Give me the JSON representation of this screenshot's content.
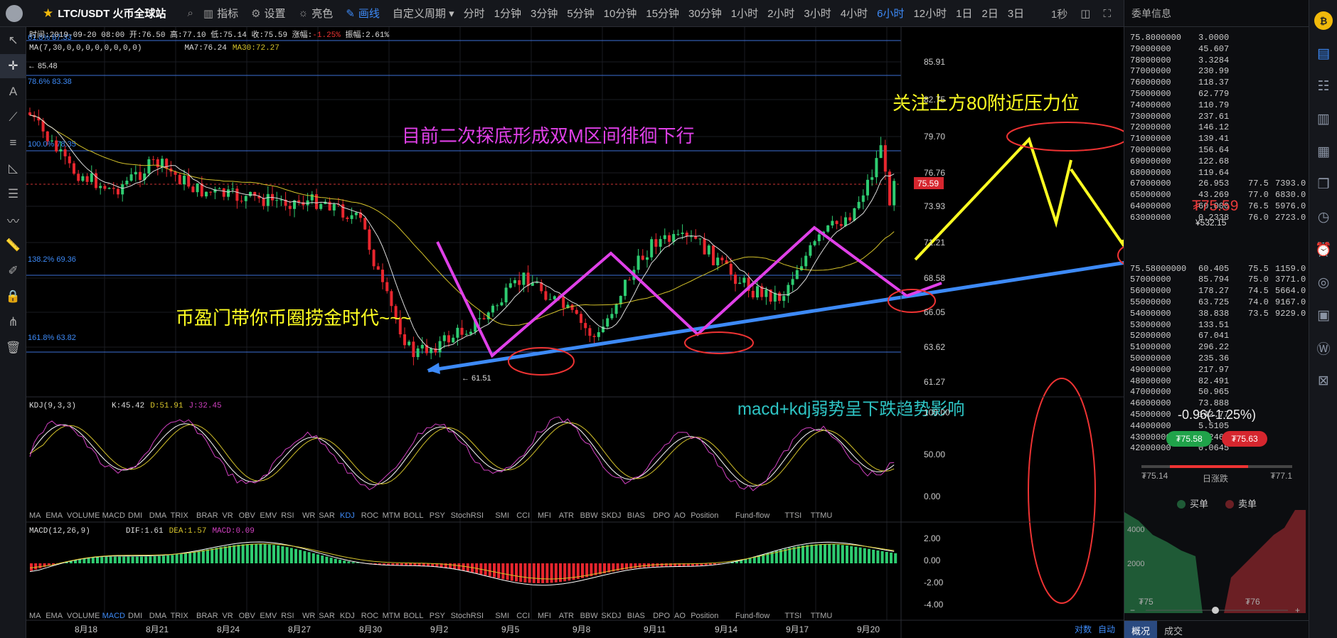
{
  "top": {
    "pair": "LTC/USDT 火币全球站",
    "tools": [
      "指标",
      "设置",
      "亮色",
      "画线"
    ],
    "periods": [
      "自定义周期",
      "分时",
      "1分钟",
      "3分钟",
      "5分钟",
      "10分钟",
      "15分钟",
      "30分钟",
      "1小时",
      "2小时",
      "3小时",
      "4小时",
      "6小时",
      "12小时",
      "1日",
      "2日",
      "3日"
    ],
    "active_period": "6小时",
    "right": [
      "1秒"
    ]
  },
  "info": {
    "line": "时间:2019-09-20 08:00  开:76.50  高:77.10  低:75.14  收:75.59",
    "change_label": "涨幅:",
    "change": "-1.25%",
    "amp": "振幅:2.61%",
    "ma_line": "MA(7,30,0,0,0,0,0,0,0,0)",
    "ma7": "MA7:76.24",
    "ma30": "MA30:72.27",
    "hi_mark": "← 85.48",
    "lo_mark": "← 61.51"
  },
  "fib": [
    "61.8% 87.33",
    "78.6% 83.38",
    "100.0% 78.35",
    "138.2% 69.36",
    "161.8% 63.82"
  ],
  "annotations": {
    "a1": "目前二次探底形成双M区间徘徊下行",
    "a2": "关注上方80附近压力位",
    "a3": "币盈门带你币圈捞金时代~~~",
    "a4": "macd+kdj弱势呈下跌趋势影响"
  },
  "price_axis": [
    "85.91",
    "82.75",
    "79.70",
    "76.76",
    "73.93",
    "71.21",
    "68.58",
    "66.05",
    "63.62",
    "61.27"
  ],
  "last_price": "75.59",
  "kdj": {
    "label": "KDJ(9,3,3)",
    "k": "K:45.42",
    "d": "D:51.91",
    "j": "J:32.45",
    "axis": [
      "100.00",
      "50.00",
      "0.00"
    ]
  },
  "macd": {
    "label": "MACD(12,26,9)",
    "dif": "DIF:1.61",
    "dea": "DEA:1.57",
    "macd": "MACD:0.09",
    "axis": [
      "2.00",
      "0.00",
      "-2.00",
      "-4.00"
    ]
  },
  "indicators": [
    "MA",
    "EMA",
    "VOLUME",
    "MACD",
    "DMI",
    "DMA",
    "TRIX",
    "BRAR",
    "VR",
    "OBV",
    "EMV",
    "RSI",
    "WR",
    "SAR",
    "KDJ",
    "ROC",
    "MTM",
    "BOLL",
    "PSY",
    "StochRSI",
    "SMI",
    "CCI",
    "MFI",
    "ATR",
    "BBW",
    "SKDJ",
    "BIAS",
    "DPO",
    "AO",
    "Position",
    "Fund-flow",
    "TTSI",
    "TTMU"
  ],
  "ind_active_1": "KDJ",
  "ind_active_2": "MACD",
  "dates": [
    "8月18",
    "8月21",
    "8月24",
    "8月27",
    "8月30",
    "9月2",
    "9月5",
    "9月8",
    "9月11",
    "9月14",
    "9月17",
    "9月20"
  ],
  "bottom_right": [
    "对数",
    "自动"
  ],
  "panel": {
    "title": "委单信息",
    "asks": [
      [
        "75.8000000",
        "3.0000"
      ],
      [
        "79000000",
        "45.607"
      ],
      [
        "78000000",
        "3.3284"
      ],
      [
        "77000000",
        "230.99"
      ],
      [
        "76000000",
        "118.37"
      ],
      [
        "75000000",
        "62.779"
      ],
      [
        "74000000",
        "110.79"
      ],
      [
        "73000000",
        "237.61"
      ],
      [
        "72000000",
        "146.12"
      ],
      [
        "71000000",
        "139.41"
      ],
      [
        "70000000",
        "156.64"
      ],
      [
        "69000000",
        "122.68"
      ],
      [
        "68000000",
        "119.64"
      ],
      [
        "67000000",
        "26.953",
        "77.5",
        "7393.0"
      ],
      [
        "65000000",
        "43.269",
        "77.0",
        "6830.0"
      ],
      [
        "64000000",
        "60.000",
        "76.5",
        "5976.0"
      ],
      [
        "63000000",
        "0.2338",
        "76.0",
        "2723.0"
      ]
    ],
    "bids": [
      [
        "75.58000000",
        "60.405",
        "75.5",
        "1159.0"
      ],
      [
        "57000000",
        "85.794",
        "75.0",
        "3771.0"
      ],
      [
        "56000000",
        "178.27",
        "74.5",
        "5664.0"
      ],
      [
        "55000000",
        "63.725",
        "74.0",
        "9167.0"
      ],
      [
        "54000000",
        "38.838",
        "73.5",
        "9229.0"
      ],
      [
        "53000000",
        "133.51"
      ],
      [
        "52000000",
        "67.041"
      ],
      [
        "51000000",
        "296.22"
      ],
      [
        "50000000",
        "235.36"
      ],
      [
        "49000000",
        "217.97"
      ],
      [
        "48000000",
        "82.491"
      ],
      [
        "47000000",
        "50.965"
      ],
      [
        "46000000",
        "73.888"
      ],
      [
        "45000000",
        "142.77"
      ],
      [
        "44000000",
        "5.5105"
      ],
      [
        "43000000",
        "5.2466"
      ],
      [
        "42000000",
        "0.0645"
      ]
    ],
    "mid_price": "₮75.59",
    "sub_price": "¥532.15",
    "change": "-0.96(-1.25%)",
    "bid_pill": "₮75.58",
    "ask_pill": "₮75.63",
    "low": "₮75.14",
    "high": "₮77.1",
    "range_label": "日涨跌",
    "buy": "买单",
    "sell": "卖单",
    "depth_y": [
      "4000",
      "2000"
    ],
    "depth_x": [
      "₮75",
      "₮76"
    ],
    "tabs": [
      "概况",
      "成交"
    ]
  },
  "colors": {
    "up": "#2ecc71",
    "down": "#e8262e",
    "ma7": "#dddddd",
    "ma30": "#d4c22a",
    "fib": "#3d6fd6",
    "accent": "#3d8af7"
  },
  "chart_data": {
    "type": "candlestick",
    "interval": "6h",
    "price_ticks": [
      85.91,
      82.75,
      79.7,
      76.76,
      73.93,
      71.21,
      68.58,
      66.05,
      63.62,
      61.27
    ],
    "fib_levels": [
      87.33,
      83.38,
      78.35,
      69.36,
      63.82
    ],
    "last": {
      "open": 76.5,
      "high": 77.1,
      "low": 75.14,
      "close": 75.59
    },
    "ma7": 76.24,
    "ma30": 72.27,
    "kdj": {
      "k": 45.42,
      "d": 51.91,
      "j": 32.45
    },
    "macd": {
      "dif": 1.61,
      "dea": 1.57,
      "macd": 0.09
    }
  }
}
